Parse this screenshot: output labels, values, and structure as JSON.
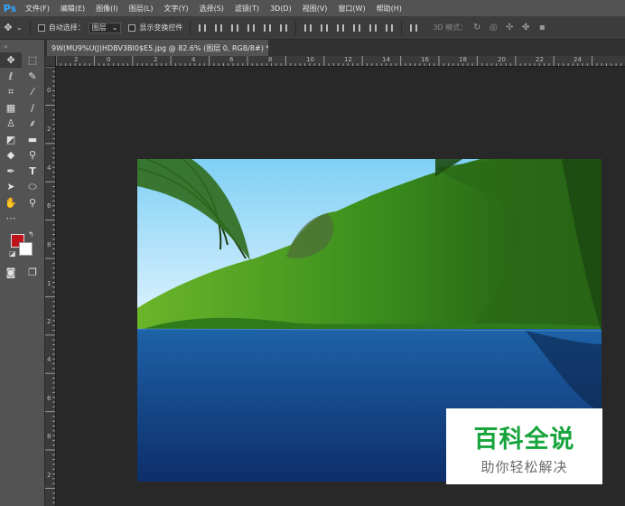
{
  "app": {
    "logo": "Ps"
  },
  "menu": [
    "文件(F)",
    "编辑(E)",
    "图像(I)",
    "图层(L)",
    "文字(Y)",
    "选择(S)",
    "滤镜(T)",
    "3D(D)",
    "视图(V)",
    "窗口(W)",
    "帮助(H)"
  ],
  "options": {
    "auto_select_label": "自动选择：",
    "auto_select_value": "图层",
    "show_transform_label": "显示变换控件",
    "mode3d_label": "3D 模式："
  },
  "document": {
    "tab_title": "9W(MU9%U(J)HDBV3BI0$E5.jpg @ 82.6% (图层 0, RGB/8#) *",
    "close_glyph": "×"
  },
  "rulers": {
    "top_labels": [
      "2",
      "0",
      "2",
      "4",
      "6",
      "8",
      "10",
      "12",
      "14",
      "16",
      "18",
      "20",
      "22",
      "24"
    ],
    "left_labels": [
      "0",
      "2",
      "4",
      "6",
      "8",
      "1",
      "2",
      "4",
      "6",
      "8",
      "2"
    ]
  },
  "watermark": {
    "title": "百科全说",
    "subtitle": "助你轻松解决"
  },
  "colors": {
    "foreground": "#c0141c",
    "background": "#ffffff",
    "accent": "#31a8ff"
  }
}
